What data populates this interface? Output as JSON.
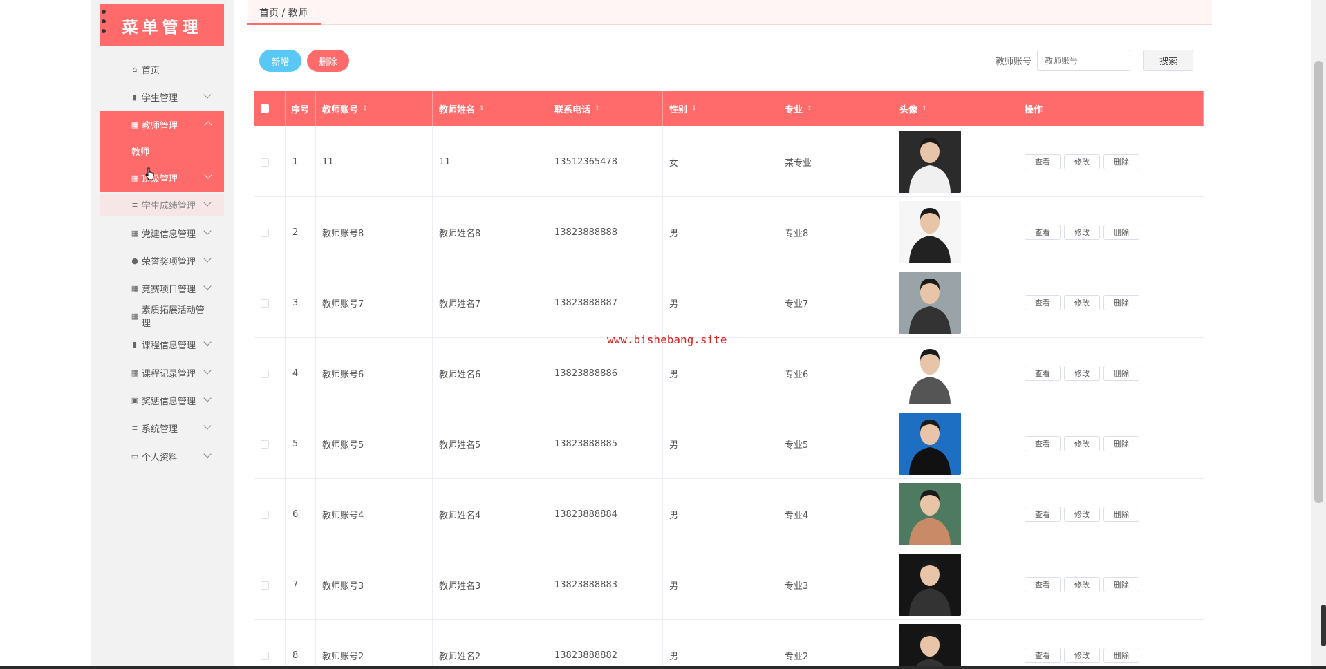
{
  "sidebar": {
    "title": "菜单管理",
    "items": [
      {
        "label": "首页",
        "icon": "home-icon",
        "glyph": "⌂"
      },
      {
        "label": "学生管理",
        "icon": "chart-icon",
        "glyph": "▮"
      },
      {
        "label": "教师管理",
        "icon": "grid-icon",
        "glyph": "▦"
      },
      {
        "label": "教师",
        "icon": "",
        "glyph": ""
      },
      {
        "label": "班级管理",
        "icon": "grid-icon",
        "glyph": "▦"
      },
      {
        "label": "学生成绩管理",
        "icon": "sliders-icon",
        "glyph": "≡"
      },
      {
        "label": "党建信息管理",
        "icon": "grid-icon",
        "glyph": "▦"
      },
      {
        "label": "荣誉奖项管理",
        "icon": "bulb-icon",
        "glyph": "●"
      },
      {
        "label": "竞赛项目管理",
        "icon": "grid-icon",
        "glyph": "▦"
      },
      {
        "label": "素质拓展活动管理",
        "icon": "grid-icon",
        "glyph": "▦"
      },
      {
        "label": "课程信息管理",
        "icon": "chart-icon",
        "glyph": "▮"
      },
      {
        "label": "课程记录管理",
        "icon": "grid-icon",
        "glyph": "▦"
      },
      {
        "label": "奖惩信息管理",
        "icon": "clipboard-icon",
        "glyph": "▣"
      },
      {
        "label": "系统管理",
        "icon": "list-icon",
        "glyph": "≡"
      },
      {
        "label": "个人资料",
        "icon": "card-icon",
        "glyph": "▭"
      }
    ]
  },
  "breadcrumb": "首页 / 教师",
  "toolbar": {
    "add_label": "新增",
    "delete_label": "删除",
    "search_label": "教师账号",
    "search_placeholder": "教师账号",
    "search_button": "搜索"
  },
  "table": {
    "headers": [
      "序号",
      "教师账号",
      "教师姓名",
      "联系电话",
      "性别",
      "专业",
      "头像",
      "操作"
    ],
    "actions": [
      "查看",
      "修改",
      "删除"
    ],
    "rows": [
      {
        "no": "1",
        "account": "11",
        "name": "11",
        "phone": "13512365478",
        "gender": "女",
        "major": "某专业",
        "avatar_bg": "#2b2b2b",
        "avatar_fg": "#f0f0f0"
      },
      {
        "no": "2",
        "account": "教师账号8",
        "name": "教师姓名8",
        "phone": "13823888888",
        "gender": "男",
        "major": "专业8",
        "avatar_bg": "#f6f6f6",
        "avatar_fg": "#222"
      },
      {
        "no": "3",
        "account": "教师账号7",
        "name": "教师姓名7",
        "phone": "13823888887",
        "gender": "男",
        "major": "专业7",
        "avatar_bg": "#9aa4a8",
        "avatar_fg": "#333"
      },
      {
        "no": "4",
        "account": "教师账号6",
        "name": "教师姓名6",
        "phone": "13823888886",
        "gender": "男",
        "major": "专业6",
        "avatar_bg": "#ffffff",
        "avatar_fg": "#555"
      },
      {
        "no": "5",
        "account": "教师账号5",
        "name": "教师姓名5",
        "phone": "13823888885",
        "gender": "男",
        "major": "专业5",
        "avatar_bg": "#1c6fc2",
        "avatar_fg": "#111"
      },
      {
        "no": "6",
        "account": "教师账号4",
        "name": "教师姓名4",
        "phone": "13823888884",
        "gender": "男",
        "major": "专业4",
        "avatar_bg": "#4e7a62",
        "avatar_fg": "#c98a68"
      },
      {
        "no": "7",
        "account": "教师账号3",
        "name": "教师姓名3",
        "phone": "13823888883",
        "gender": "男",
        "major": "专业3",
        "avatar_bg": "#151515",
        "avatar_fg": "#333"
      },
      {
        "no": "8",
        "account": "教师账号2",
        "name": "教师姓名2",
        "phone": "13823888882",
        "gender": "男",
        "major": "专业2",
        "avatar_bg": "#151515",
        "avatar_fg": "#333"
      }
    ]
  },
  "watermark": "www.bishebang.site",
  "colors": {
    "accent": "#ff6b6b",
    "add_button": "#5ac8f5",
    "sidebar_bg": "#f2f2f2"
  }
}
